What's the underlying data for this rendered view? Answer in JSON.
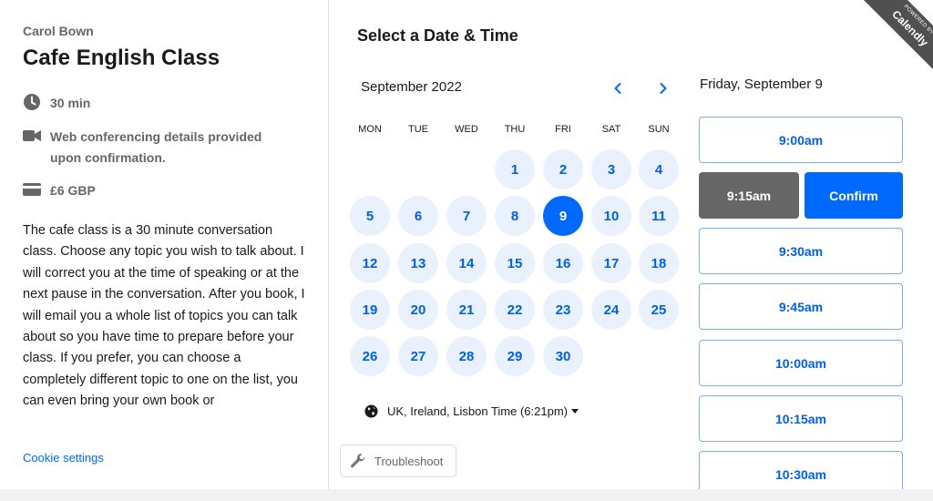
{
  "event": {
    "organizer": "Carol Bown",
    "title": "Cafe English Class",
    "duration": "30 min",
    "location": "Web conferencing details provided upon confirmation.",
    "price": "£6 GBP",
    "description": "The cafe class is a 30 minute conversation class. Choose any topic you wish to talk about. I will correct you at the time of speaking or at the next pause in the conversation. After you book, I will email you a whole list of topics you can talk about so you have time to prepare before your class. If you prefer, you can choose a completely different topic to one on the list, you can even bring your own book or"
  },
  "cookie_settings": "Cookie settings",
  "scheduler": {
    "heading": "Select a Date & Time",
    "month": "September 2022",
    "weekdays": [
      "MON",
      "TUE",
      "WED",
      "THU",
      "FRI",
      "SAT",
      "SUN"
    ],
    "days": [
      "1",
      "2",
      "3",
      "4",
      "5",
      "6",
      "7",
      "8",
      "9",
      "10",
      "11",
      "12",
      "13",
      "14",
      "15",
      "16",
      "17",
      "18",
      "19",
      "20",
      "21",
      "22",
      "23",
      "24",
      "25",
      "26",
      "27",
      "28",
      "29",
      "30"
    ],
    "selected_day": "9",
    "timezone": "UK, Ireland, Lisbon Time (6:21pm)",
    "troubleshoot": "Troubleshoot"
  },
  "times": {
    "selected_date": "Friday, September 9",
    "selected_time": "9:15am",
    "confirm": "Confirm",
    "slots": [
      "9:00am",
      "9:30am",
      "9:45am",
      "10:00am",
      "10:15am",
      "10:30am"
    ]
  },
  "badge": {
    "powered": "POWERED BY",
    "brand": "Calendly"
  },
  "icons": {
    "clock": "clock-icon",
    "video": "video-camera-icon",
    "card": "credit-card-icon",
    "globe": "globe-icon",
    "wrench": "wrench-icon"
  },
  "colors": {
    "accent": "#0069ff",
    "day_bg": "#e9f1ff",
    "selected_time_bg": "#666666",
    "ribbon": "#505050"
  }
}
